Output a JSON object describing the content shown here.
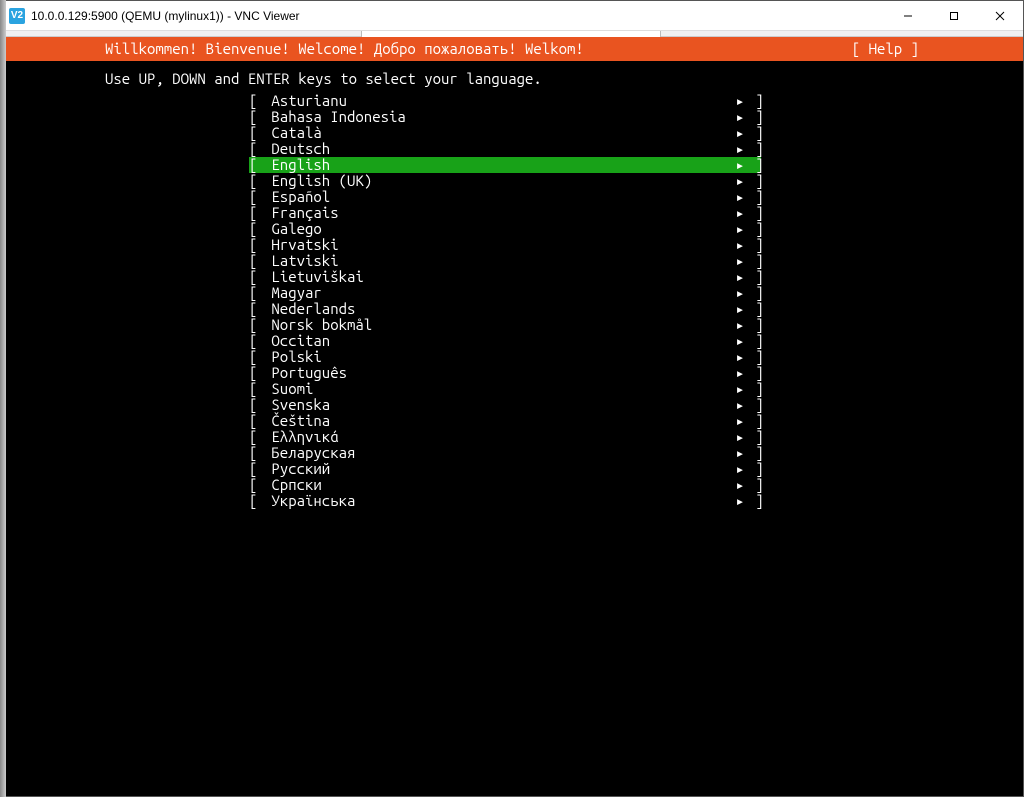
{
  "window": {
    "app_icon_text": "V2",
    "title": "10.0.0.129:5900 (QEMU (mylinux1)) - VNC Viewer"
  },
  "header": {
    "welcome_text": "Willkommen! Bienvenue! Welcome! Добро пожаловать! Welkom!",
    "help_text": "[ Help ]"
  },
  "instruction": "Use UP, DOWN and ENTER keys to select your language.",
  "selected_index": 4,
  "languages": [
    "Asturianu",
    "Bahasa Indonesia",
    "Català",
    "Deutsch",
    "English",
    "English (UK)",
    "Español",
    "Français",
    "Galego",
    "Hrvatski",
    "Latviski",
    "Lietuviškai",
    "Magyar",
    "Nederlands",
    "Norsk bokmål",
    "Occitan",
    "Polski",
    "Português",
    "Suomi",
    "Svenska",
    "Čeština",
    "Ελληνικά",
    "Беларуская",
    "Русский",
    "Српски",
    "Українська"
  ]
}
